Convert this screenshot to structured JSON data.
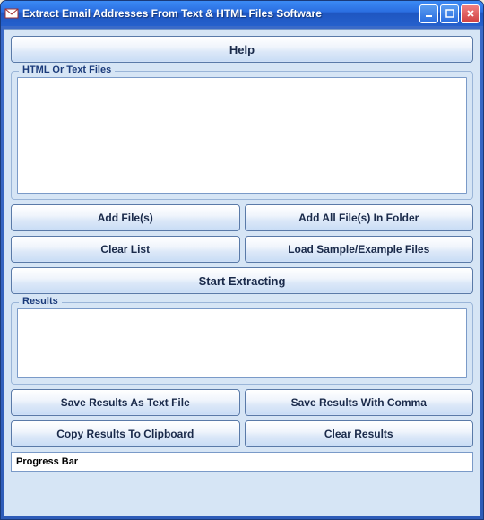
{
  "window": {
    "title": "Extract Email Addresses From Text & HTML Files Software"
  },
  "buttons": {
    "help": "Help",
    "add_files": "Add File(s)",
    "add_all_folder": "Add All File(s) In Folder",
    "clear_list": "Clear List",
    "load_sample": "Load Sample/Example Files",
    "start_extracting": "Start Extracting",
    "save_text": "Save Results As Text File",
    "save_comma": "Save Results With Comma",
    "copy_clipboard": "Copy Results To Clipboard",
    "clear_results": "Clear Results"
  },
  "groups": {
    "files_label": "HTML Or Text Files",
    "results_label": "Results"
  },
  "status": {
    "progress_label": "Progress Bar"
  }
}
